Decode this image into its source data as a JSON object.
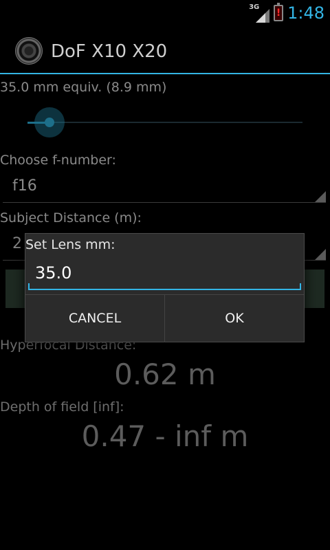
{
  "status_bar": {
    "network_label": "3G",
    "time": "1:48",
    "battery_alert": "!",
    "accent_color": "#33b5e5"
  },
  "app": {
    "title": "DoF X10 X20",
    "icon": "lens-icon"
  },
  "focal": {
    "label": "35.0 mm equiv. (8.9 mm)",
    "slider_level": 0.08
  },
  "fnumber": {
    "label": "Choose f-number:",
    "value": "f16"
  },
  "distance": {
    "label": "Subject Distance (m):",
    "value": "2"
  },
  "results": {
    "hyperfocal_label": "Hyperfocal Distance:",
    "hyperfocal_value": "0.62 m",
    "dof_label": "Depth of field [inf]:",
    "dof_value": "0.47 - inf m"
  },
  "dialog": {
    "title": "Set Lens mm:",
    "input_value": "35.0",
    "cancel_label": "CANCEL",
    "ok_label": "OK"
  }
}
